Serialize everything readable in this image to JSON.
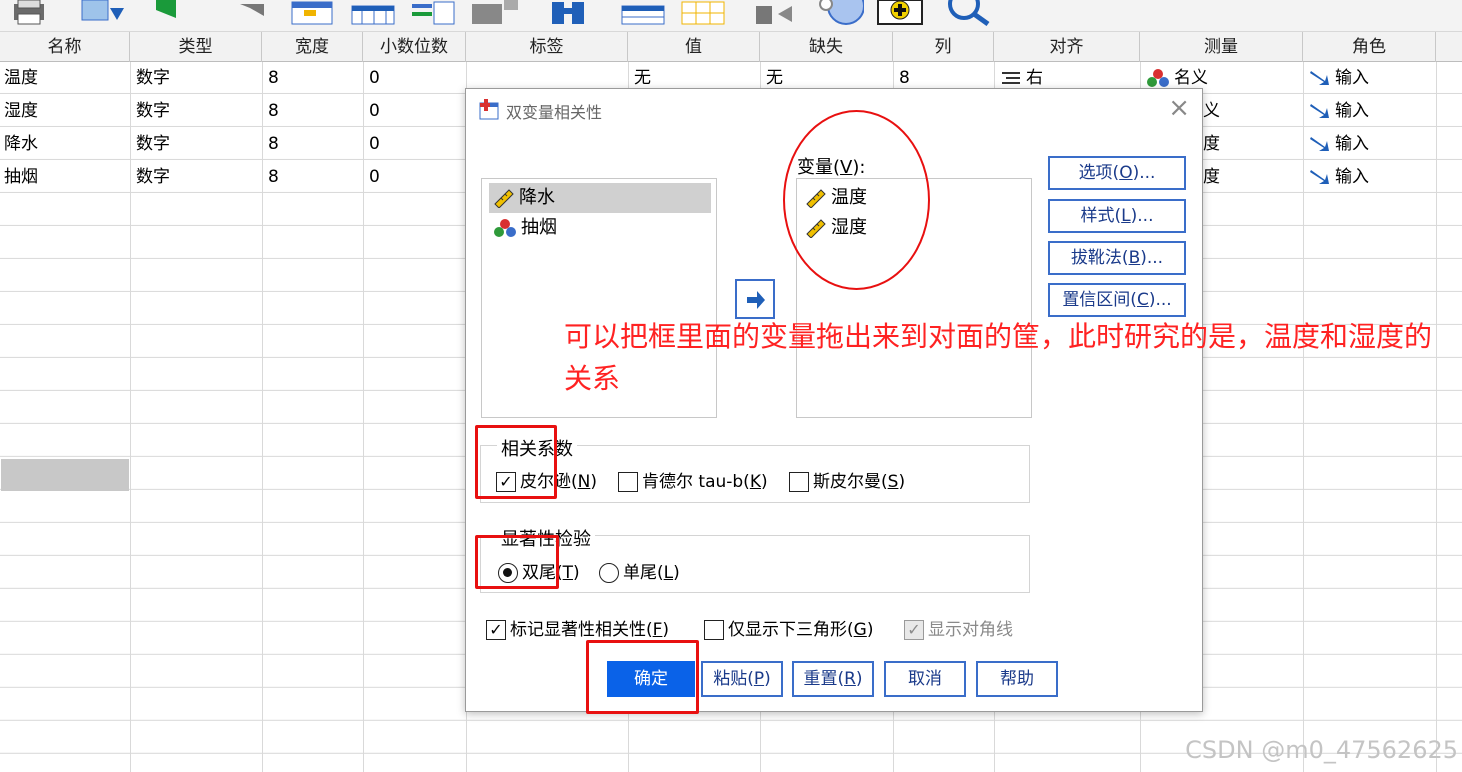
{
  "grid": {
    "headers": [
      "名称",
      "类型",
      "宽度",
      "小数位数",
      "标签",
      "值",
      "缺失",
      "列",
      "对齐",
      "测量",
      "角色"
    ],
    "rows": [
      {
        "name": "温度",
        "type": "数字",
        "width": "8",
        "decimals": "0",
        "values": "无",
        "missing": "无",
        "columns": "8",
        "align": "右",
        "measure": "名义",
        "role": "输入"
      },
      {
        "name": "湿度",
        "type": "数字",
        "width": "8",
        "decimals": "0",
        "measure": "义",
        "role": "输入"
      },
      {
        "name": "降水",
        "type": "数字",
        "width": "8",
        "decimals": "0",
        "measure": "度",
        "role": "输入"
      },
      {
        "name": "抽烟",
        "type": "数字",
        "width": "8",
        "decimals": "0",
        "measure": "度",
        "role": "输入"
      }
    ]
  },
  "dialog": {
    "title": "双变量相关性",
    "source_list": [
      "降水",
      "抽烟"
    ],
    "variables_label": "变量(",
    "variables_key": "V",
    "variables_suffix": "):",
    "variables_list": [
      "温度",
      "湿度"
    ],
    "side_buttons": [
      {
        "pre": "选项(",
        "key": "O",
        "post": ")..."
      },
      {
        "pre": "样式(",
        "key": "L",
        "post": ")..."
      },
      {
        "pre": "拔靴法(",
        "key": "B",
        "post": ")..."
      },
      {
        "pre": "置信区间(",
        "key": "C",
        "post": ")..."
      }
    ],
    "corr_group_title": "相关系数",
    "corr_options": [
      {
        "pre": "皮尔逊(",
        "key": "N",
        "post": ")",
        "checked": true
      },
      {
        "pre": "肯德尔 tau-b(",
        "key": "K",
        "post": ")",
        "checked": false
      },
      {
        "pre": "斯皮尔曼(",
        "key": "S",
        "post": ")",
        "checked": false
      }
    ],
    "sig_group_title": "显著性检验",
    "sig_options": [
      {
        "pre": "双尾(",
        "key": "T",
        "post": ")",
        "selected": true
      },
      {
        "pre": "单尾(",
        "key": "L",
        "post": ")",
        "selected": false
      }
    ],
    "bottom_checks": [
      {
        "pre": "标记显著性相关性(",
        "key": "F",
        "post": ")",
        "checked": true
      },
      {
        "pre": "仅显示下三角形(",
        "key": "G",
        "post": ")",
        "checked": false
      },
      {
        "pre": "显示对角线",
        "key": "",
        "post": "",
        "checked": true,
        "disabled": true
      }
    ],
    "buttons": [
      {
        "pre": "确定",
        "key": "",
        "post": ""
      },
      {
        "pre": "粘贴(",
        "key": "P",
        "post": ")"
      },
      {
        "pre": "重置(",
        "key": "R",
        "post": ")"
      },
      {
        "pre": "取消",
        "key": "",
        "post": ""
      },
      {
        "pre": "帮助",
        "key": "",
        "post": ""
      }
    ]
  },
  "annotation": {
    "text": "可以把框里面的变量拖出来到对面的筐，此时研究的是，温度和湿度的关系",
    "color": "#ff2222"
  },
  "watermark": "CSDN @m0_47562625",
  "colors": {
    "accent": "#0a62e8",
    "annotation": "#e81010"
  }
}
